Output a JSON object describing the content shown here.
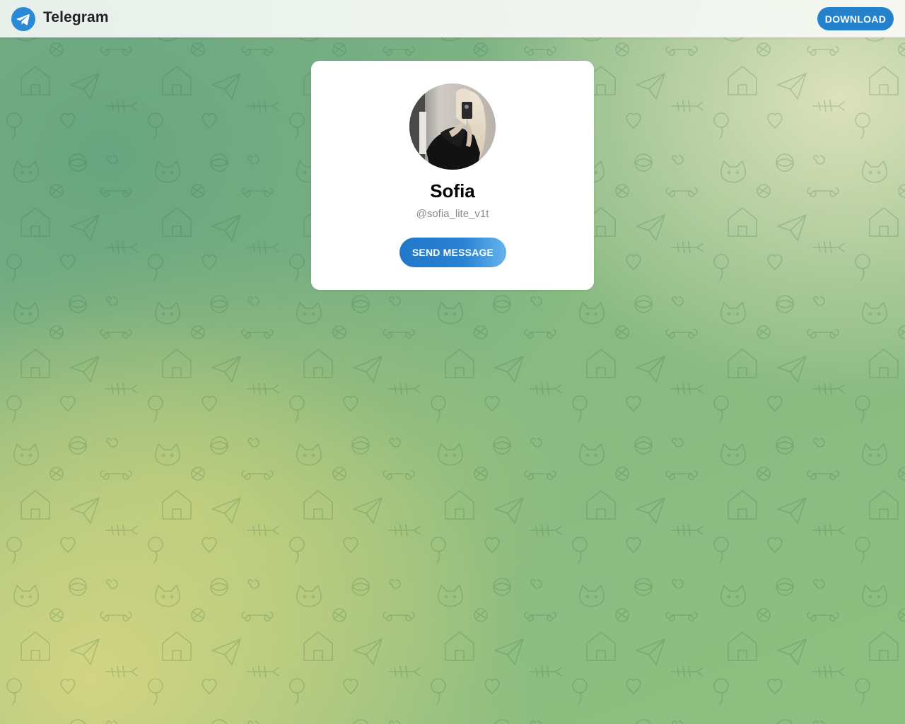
{
  "header": {
    "app_name": "Telegram",
    "download_label": "DOWNLOAD"
  },
  "profile": {
    "name": "Sofia",
    "username": "@sofia_lite_v1t",
    "send_message_label": "SEND MESSAGE"
  },
  "icons": {
    "logo": "telegram-paper-plane-icon"
  },
  "colors": {
    "accent": "#2481cc",
    "card_background": "#ffffff",
    "header_background": "#f3f6f1",
    "username_text": "#8a8a8a"
  }
}
